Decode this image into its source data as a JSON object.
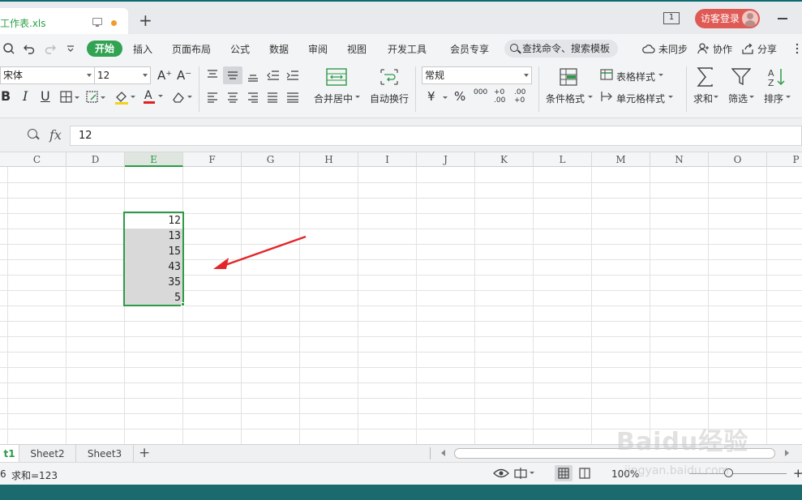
{
  "window": {
    "doc_tab_title": "工作表.xls",
    "new_tab_symbol": "+",
    "window_count": "1",
    "login_label": "访客登录"
  },
  "menu": {
    "start": "开始",
    "items": [
      "插入",
      "页面布局",
      "公式",
      "数据",
      "审阅",
      "视图",
      "开发工具",
      "会员专享"
    ],
    "search_placeholder": "查找命令、搜索模板",
    "sync": "未同步",
    "collab": "协作",
    "share": "分享"
  },
  "ribbon": {
    "font_name": "宋体",
    "font_size": "12",
    "grow_font": "A⁺",
    "shrink_font": "A⁻",
    "bold": "B",
    "italic": "I",
    "underline": "U",
    "merge_center": "合并居中",
    "wrap_text": "自动换行",
    "number_format": "常规",
    "currency": "¥",
    "percent": "%",
    "thousands": "000",
    "inc_decimal": "+0 .00",
    "dec_decimal": ".00 +0",
    "conditional_format": "条件格式",
    "table_style": "表格样式",
    "cell_style": "单元格样式",
    "sum": "求和",
    "filter": "筛选",
    "sort": "排序"
  },
  "formula_bar": {
    "fx": "fx",
    "value": "12"
  },
  "grid": {
    "columns": [
      "C",
      "D",
      "E",
      "F",
      "G",
      "H",
      "I",
      "J",
      "K",
      "L",
      "M",
      "N",
      "O",
      "P"
    ],
    "active_column": "E",
    "values": [
      "12",
      "13",
      "15",
      "43",
      "35",
      "5"
    ]
  },
  "sheets": {
    "tabs": [
      "t1",
      "Sheet2",
      "Sheet3"
    ],
    "add": "+"
  },
  "status": {
    "count": "6",
    "sum_label": "求和=123",
    "zoom": "100%",
    "plus": "+"
  },
  "watermark": {
    "text": "Baidu经验",
    "url": "jingyan.baidu.com"
  },
  "colors": {
    "accent_green": "#2f9a49",
    "login_red": "#e05a55",
    "arrow_red": "#e3262a"
  }
}
